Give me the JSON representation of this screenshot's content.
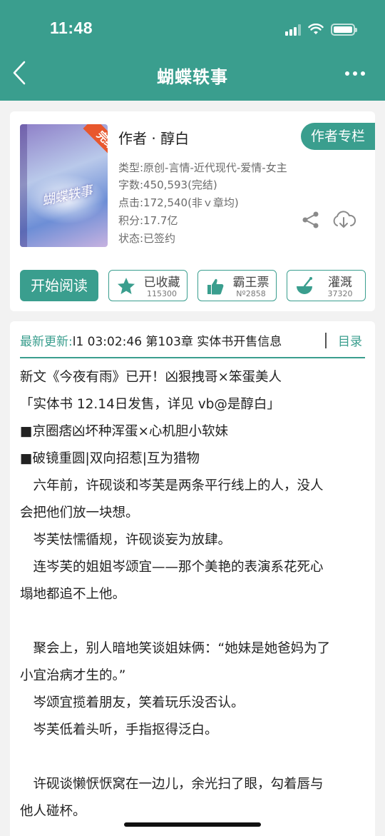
{
  "status_bar": {
    "time": "11:48"
  },
  "nav": {
    "title": "蝴蝶轶事",
    "back_icon": "chevron-left-icon",
    "more_icon": "more-dots-icon"
  },
  "book": {
    "ribbon": "完结",
    "cover_title": "蝴蝶轶事",
    "author": "作者 · 醇白",
    "author_button": "作者专栏",
    "type": "类型:原创-言情-近代现代-爱情-女主",
    "words": "字数:450,593(完结)",
    "clicks": "点击:172,540(非ｖ章均)",
    "score": "积分:17.7亿",
    "status": "状态:已签约"
  },
  "actions": {
    "read": "开始阅读",
    "favorite": {
      "label": "已收藏",
      "count": "115300"
    },
    "ticket": {
      "label": "霸王票",
      "count": "Nº2858"
    },
    "water": {
      "label": "灌溉",
      "count": "37320"
    }
  },
  "latest": {
    "label": "最新更新:",
    "value": "l1 03:02:46  第103章 实体书开售信息",
    "toc": "目录"
  },
  "intro": [
    "新文《今夜有雨》已开！凶狠拽哥×笨蛋美人",
    "「实体书 12.14日发售，详见 vb@是醇白」",
    "■京圈痞凶坏种浑蛋×心机胆小软妹",
    "■破镜重圆|双向招惹|互为猎物",
    "　六年前，许砚谈和岑芙是两条平行线上的人，没人",
    "会把他们放一块想。",
    "　岑芙怯懦循规，许砚谈妄为放肆。",
    "　连岑芙的姐姐岑颂宜——那个美艳的表演系花死心",
    "塌地都追不上他。",
    "",
    "　聚会上，别人暗地笑谈姐妹俩：“她妹是她爸妈为了",
    "小宜治病才生的。”",
    "　岑颂宜揽着朋友，笑着玩乐没否认。",
    "　岑芙低着头听，手指抠得泛白。",
    "",
    "　许砚谈懒恹恹窝在一边儿，余光扫了眼，勾着唇与",
    "他人碰杯。"
  ],
  "colors": {
    "primary": "#3a9e8e",
    "ribbon": "#e8572d"
  }
}
